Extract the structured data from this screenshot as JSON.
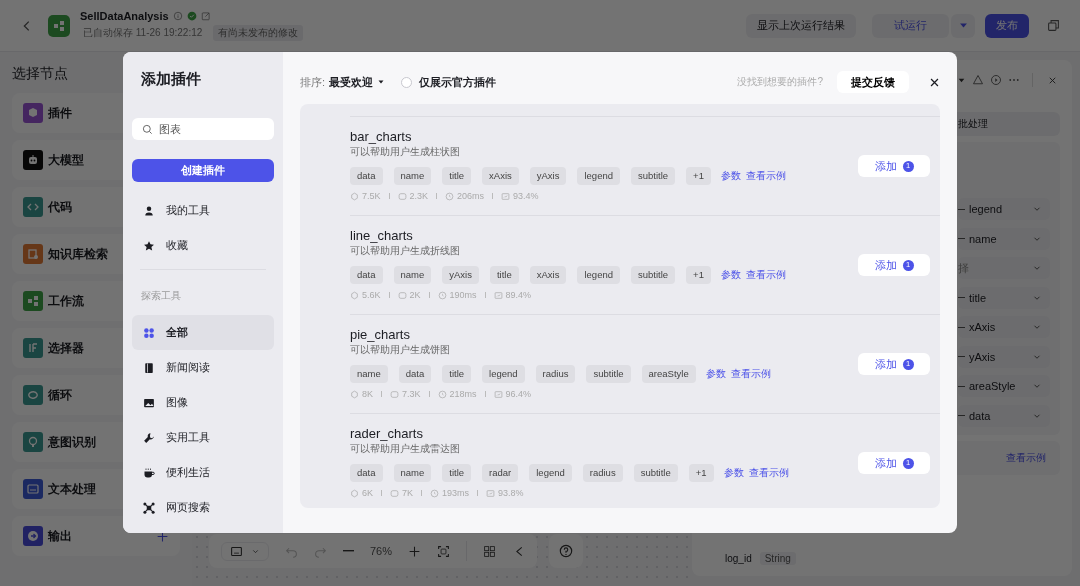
{
  "header": {
    "title": "SellDataAnalysis",
    "saved": "已自动保存 11-26 19:22:12",
    "unpublished": "有尚未发布的修改",
    "buttons": [
      {
        "label": "显示上次运行结果",
        "kind": "secondary"
      },
      {
        "label": "试运行",
        "kind": "run"
      },
      {
        "label": "发布",
        "kind": "primary"
      }
    ]
  },
  "node_panel": {
    "title": "选择节点",
    "items": [
      {
        "label": "插件",
        "kind": "plugin"
      },
      {
        "label": "大模型",
        "kind": "llm"
      },
      {
        "label": "代码",
        "kind": "code"
      },
      {
        "label": "知识库检索",
        "kind": "knowledge"
      },
      {
        "label": "工作流",
        "kind": "workflow"
      },
      {
        "label": "选择器",
        "kind": "selector"
      },
      {
        "label": "循环",
        "kind": "loop"
      },
      {
        "label": "意图识别",
        "kind": "intent"
      },
      {
        "label": "文本处理",
        "kind": "text"
      },
      {
        "label": "输出",
        "kind": "output"
      }
    ]
  },
  "canvas_toolbar": {
    "zoom": "76%"
  },
  "inspector": {
    "batch_label": "批处理",
    "fields": [
      {
        "label": "legend",
        "kind": "param"
      },
      {
        "label": "name",
        "kind": "param"
      },
      {
        "label": "择",
        "kind": "placeholder"
      },
      {
        "label": "title",
        "kind": "param"
      },
      {
        "label": "xAxis",
        "kind": "param"
      },
      {
        "label": "yAxis",
        "kind": "param"
      },
      {
        "label": "areaStyle",
        "kind": "param"
      },
      {
        "label": "data",
        "kind": "param"
      }
    ],
    "example_link": "查看示例",
    "outputs": [
      {
        "name": "log_id",
        "type": "String"
      }
    ]
  },
  "modal": {
    "title": "添加插件",
    "search": {
      "value": "图表"
    },
    "create_button": "创建插件",
    "my_items": [
      {
        "label": "我的工具",
        "kind": "user"
      },
      {
        "label": "收藏",
        "kind": "star"
      }
    ],
    "section_label": "探索工具",
    "categories": [
      {
        "label": "全部",
        "kind": "all",
        "selected": true
      },
      {
        "label": "新闻阅读",
        "kind": "news",
        "selected": false
      },
      {
        "label": "图像",
        "kind": "image",
        "selected": false
      },
      {
        "label": "实用工具",
        "kind": "tools",
        "selected": false
      },
      {
        "label": "便利生活",
        "kind": "life",
        "selected": false
      },
      {
        "label": "网页搜索",
        "kind": "web",
        "selected": false
      }
    ],
    "sort_label": "排序:",
    "sort_value": "最受欢迎",
    "official_only": {
      "label": "仅展示官方插件",
      "checked": false
    },
    "hint": "没找到想要的插件?",
    "feedback_button": "提交反馈",
    "plugins": [
      {
        "name": "bar_charts",
        "description": "可以帮助用户生成柱状图",
        "params": [
          "data",
          "name",
          "title",
          "xAxis",
          "yAxis",
          "legend",
          "subtitle",
          "+1"
        ],
        "params_link": "参数",
        "example_link": "查看示例",
        "stats": {
          "uses": "7.5K",
          "comments": "2.3K",
          "latency": "206ms",
          "success": "93.4%"
        },
        "add_label": "添加",
        "add_count": "1"
      },
      {
        "name": "line_charts",
        "description": "可以帮助用户生成折线图",
        "params": [
          "data",
          "name",
          "yAxis",
          "title",
          "xAxis",
          "legend",
          "subtitle",
          "+1"
        ],
        "params_link": "参数",
        "example_link": "查看示例",
        "stats": {
          "uses": "5.6K",
          "comments": "2K",
          "latency": "190ms",
          "success": "89.4%"
        },
        "add_label": "添加",
        "add_count": "1"
      },
      {
        "name": "pie_charts",
        "description": "可以帮助用户生成饼图",
        "params": [
          "name",
          "data",
          "title",
          "legend",
          "radius",
          "subtitle",
          "areaStyle"
        ],
        "params_link": "参数",
        "example_link": "查看示例",
        "stats": {
          "uses": "8K",
          "comments": "7.3K",
          "latency": "218ms",
          "success": "96.4%"
        },
        "add_label": "添加",
        "add_count": "1"
      },
      {
        "name": "rader_charts",
        "description": "可以帮助用户生成雷达图",
        "params": [
          "data",
          "name",
          "title",
          "radar",
          "legend",
          "radius",
          "subtitle",
          "+1"
        ],
        "params_link": "参数",
        "example_link": "查看示例",
        "stats": {
          "uses": "6K",
          "comments": "7K",
          "latency": "193ms",
          "success": "93.8%"
        },
        "add_label": "添加",
        "add_count": "1"
      }
    ]
  }
}
